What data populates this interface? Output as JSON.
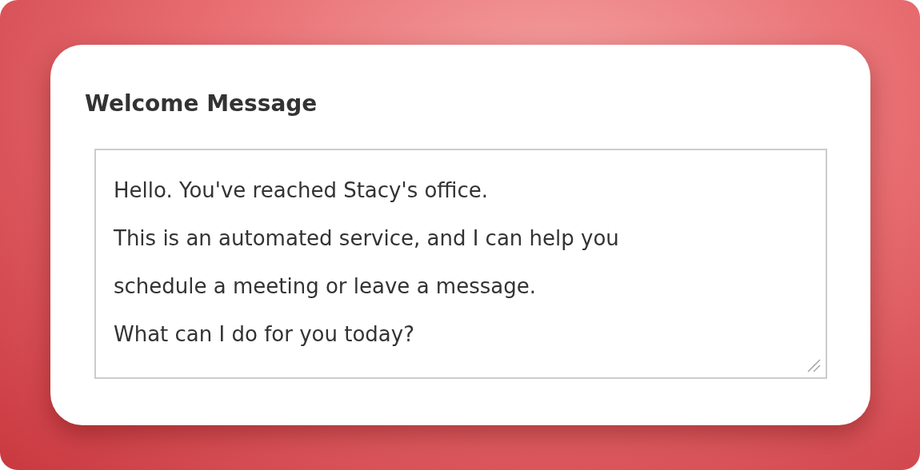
{
  "card": {
    "title": "Welcome Message",
    "message_field": {
      "value": "Hello. You've reached Stacy's office.\nThis is an automated service, and I can help you\nschedule a meeting or leave a message.\nWhat can I do for you today?"
    }
  }
}
